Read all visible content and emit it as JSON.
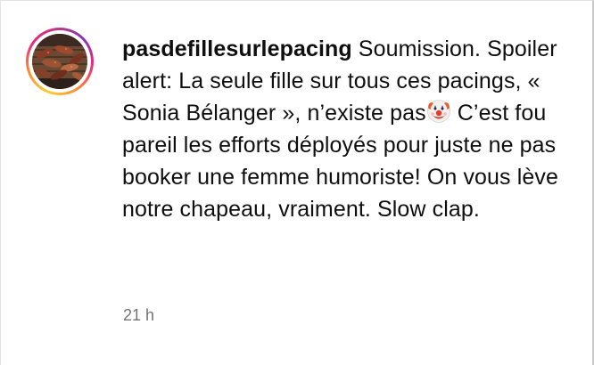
{
  "comment": {
    "username": "pasdefillesurlepacing",
    "text_before_emoji": " Soumission. Spoiler alert: La seule fille sur tous ces pacings, « Sonia Bélanger », n’existe pas",
    "emoji": "clown-face",
    "text_after_emoji": " C’est fou pareil les efforts déployés pour juste ne pas booker une femme humoriste! On vous lève notre chapeau, vraiment. Slow clap.",
    "timestamp": "21 h"
  },
  "colors": {
    "story_ring": [
      "#f9ce34",
      "#ee2a7b",
      "#833ab4"
    ],
    "meta_text": "#737373"
  }
}
